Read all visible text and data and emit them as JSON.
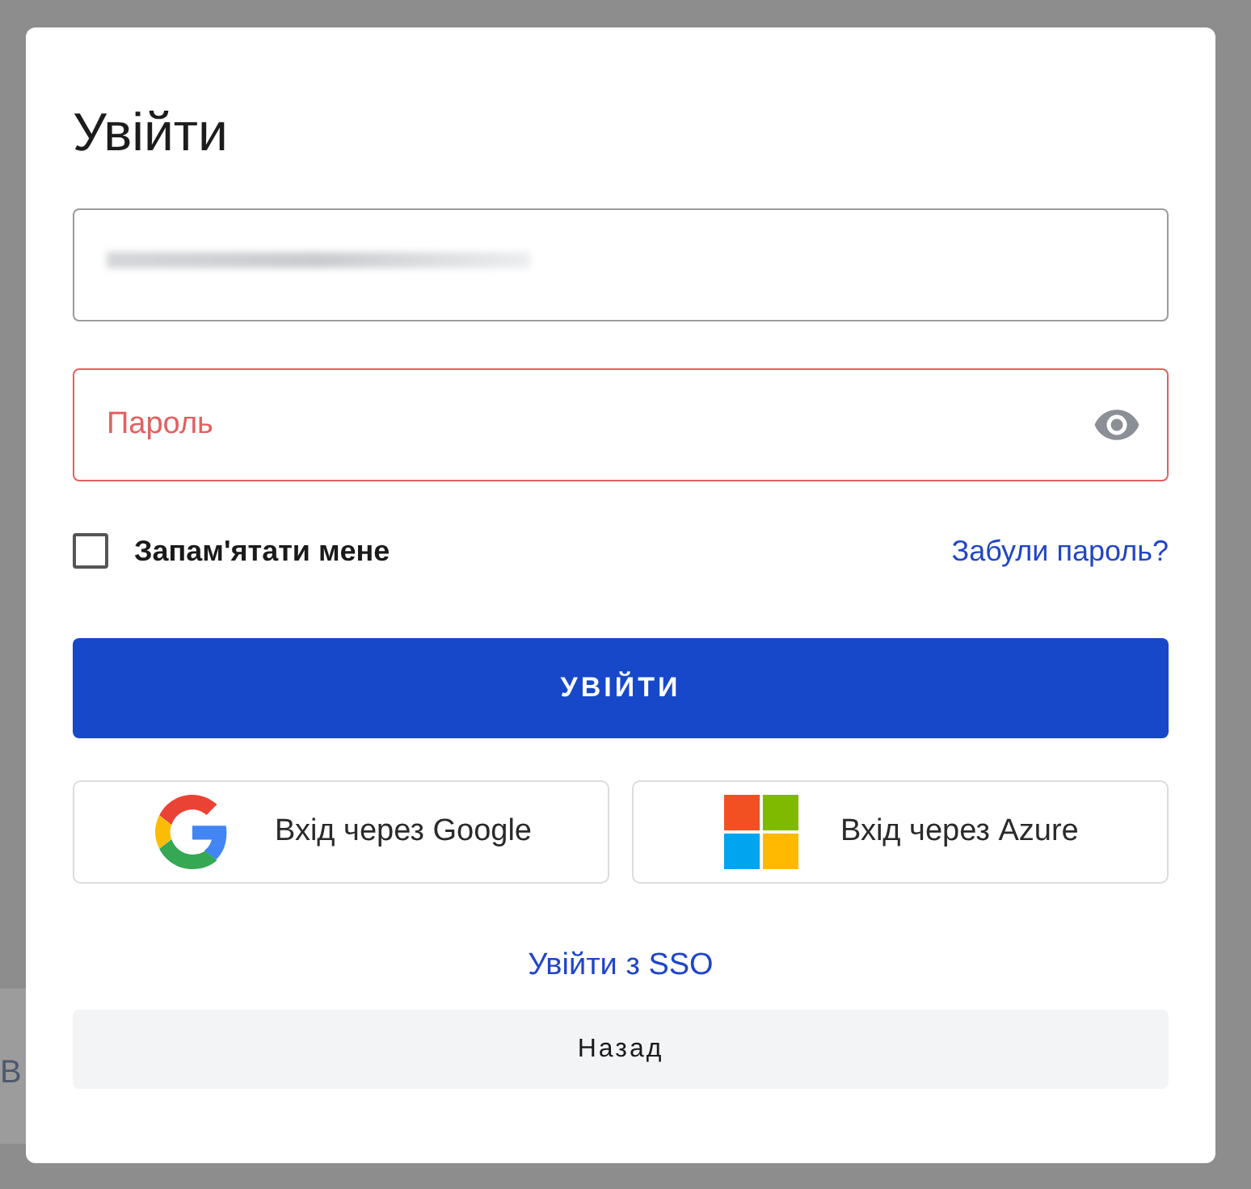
{
  "backdrop_text": "В",
  "dialog": {
    "title": "Увійти",
    "password": {
      "placeholder": "Пароль",
      "error": true
    },
    "remember": {
      "label": "Запам'ятати мене",
      "checked": false
    },
    "forgot_link": "Забули пароль?",
    "submit": "УВІЙТИ",
    "providers": [
      {
        "kind": "google",
        "label": "Вхід через Google"
      },
      {
        "kind": "microsoft",
        "label": "Вхід через Azure"
      }
    ],
    "sso_link": "Увійти з SSO",
    "back": "Назад"
  }
}
